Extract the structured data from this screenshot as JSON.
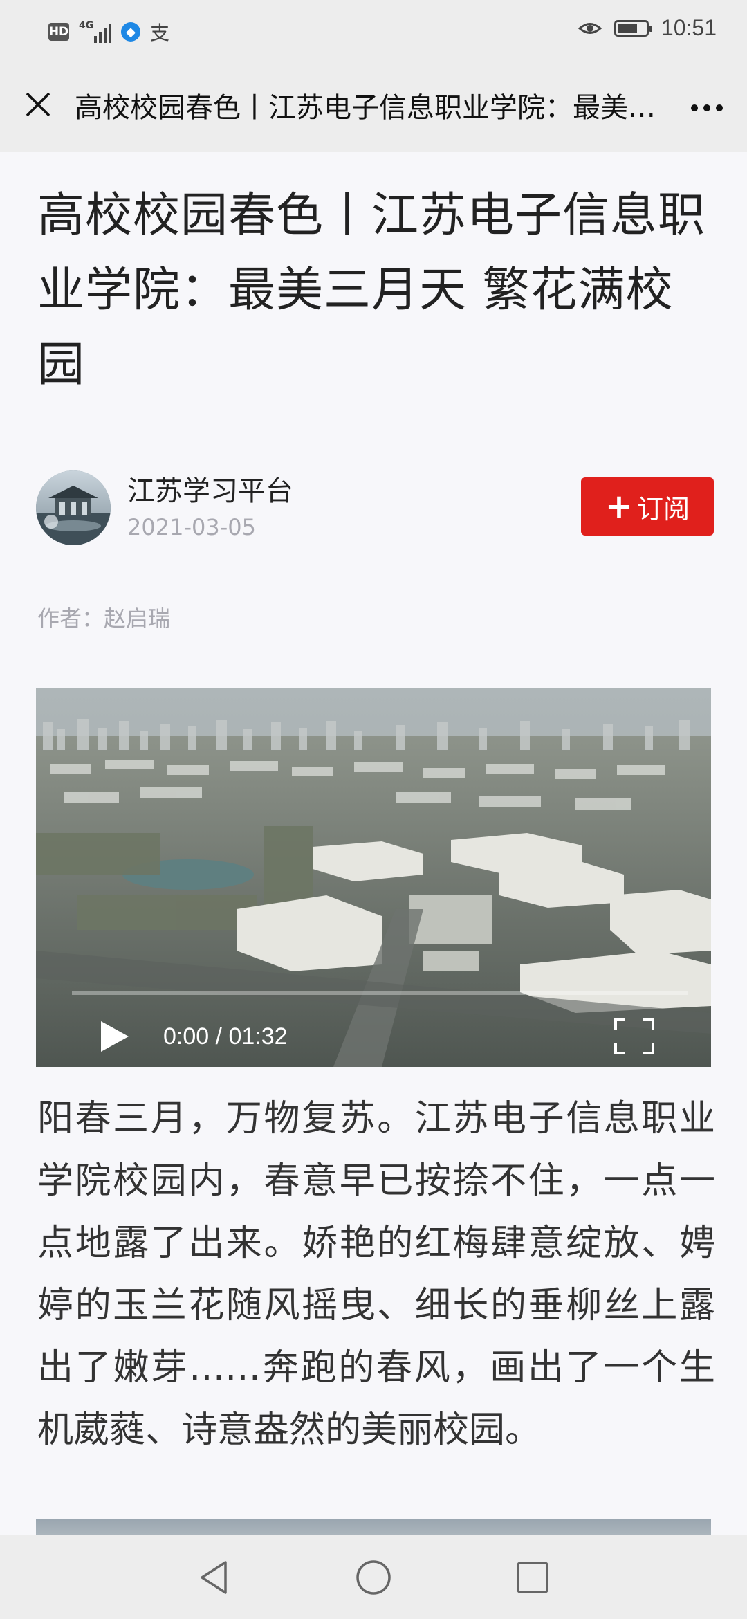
{
  "status_bar": {
    "hd": "HD",
    "network": "4G",
    "time": "10:51",
    "battery_level": 0.7,
    "icons": [
      "hd-icon",
      "signal-icon",
      "app-notification-icon",
      "alipay-icon",
      "eye-comfort-icon",
      "battery-icon"
    ]
  },
  "nav": {
    "title": "高校校园春色丨江苏电子信息职业学院：最美三月天 繁花满校园",
    "close_icon": "close-icon",
    "more_icon": "more-icon"
  },
  "article": {
    "title": "高校校园春色丨江苏电子信息职业学院：最美三月天 繁花满校园",
    "account_name": "江苏学习平台",
    "publish_date": "2021-03-05",
    "subscribe_label": "订阅",
    "author_line": "作者：赵启瑞",
    "video": {
      "time_display": "0:00 / 01:32",
      "progress": 0.0
    },
    "paragraph": "阳春三月，万物复苏。江苏电子信息职业学院校园内，春意早已按捺不住，一点一点地露了出来。娇艳的红梅肆意绽放、娉婷的玉兰花随风摇曳、细长的垂柳丝上露出了嫩芽……奔跑的春风，画出了一个生机葳蕤、诗意盎然的美丽校园。"
  },
  "colors": {
    "accent_red": "#e0201c",
    "bar_gray": "#ededed",
    "meta_gray": "#a8a8b0"
  }
}
